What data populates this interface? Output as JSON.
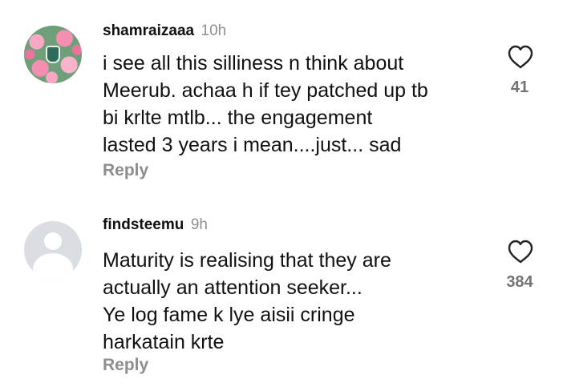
{
  "comments": [
    {
      "username": "shamraizaaa",
      "time": "10h",
      "lines": [
        "i see all this silliness n think about",
        "Meerub. achaa h if tey patched up tb",
        "bi krlte mtlb... the engagement",
        "lasted 3 years i mean....just... sad"
      ],
      "reply_label": "Reply",
      "likes": "41",
      "avatar_icon": "rose-pattern-avatar"
    },
    {
      "username": "findsteemu",
      "time": "9h",
      "lines": [
        "Maturity is realising that they are",
        "actually an attention seeker...",
        "Ye log fame k lye aisii cringe",
        "harkatain krte"
      ],
      "reply_label": "Reply",
      "likes": "384",
      "avatar_icon": "default-user-avatar"
    }
  ],
  "colors": {
    "text": "#111111",
    "muted": "#8e8e8e",
    "count": "#737373",
    "heart_stroke": "#222222"
  },
  "icons": {
    "like": "heart-outline-icon"
  }
}
